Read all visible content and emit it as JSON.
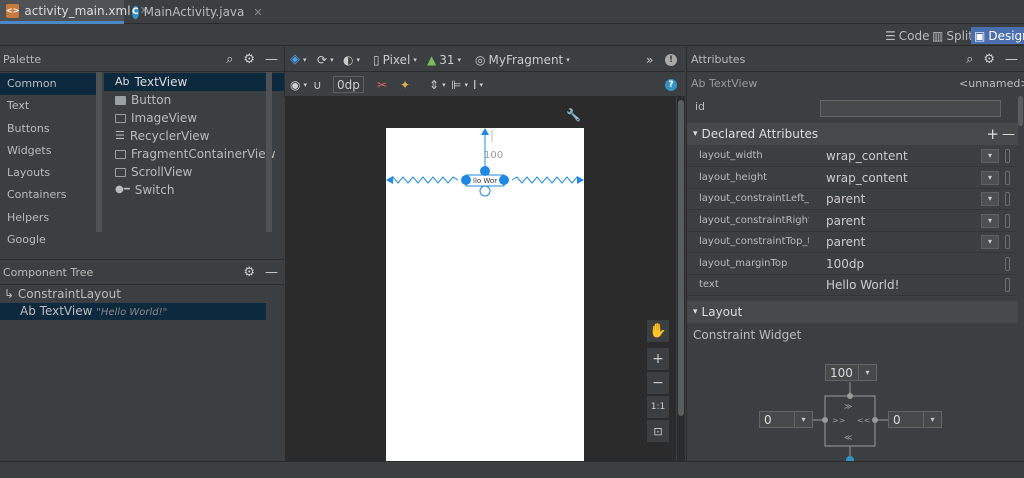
{
  "tabs": [
    {
      "label": "activity_main.xml",
      "icon": "xml-layout-icon"
    },
    {
      "label": "MainActivity.java",
      "icon": "java-class-icon"
    }
  ],
  "view_modes": {
    "code": "Code",
    "split": "Split",
    "design": "Design"
  },
  "palette": {
    "title": "Palette",
    "categories": [
      "Common",
      "Text",
      "Buttons",
      "Widgets",
      "Layouts",
      "Containers",
      "Helpers",
      "Google"
    ],
    "items": [
      "TextView",
      "Button",
      "ImageView",
      "RecyclerView",
      "FragmentContainerView",
      "ScrollView",
      "Switch"
    ],
    "textview_prefix": "Ab"
  },
  "component_tree": {
    "title": "Component Tree",
    "root": "ConstraintLayout",
    "child_prefix": "Ab",
    "child": "TextView",
    "child_hint": "\"Hello World!\""
  },
  "design_toolbar": {
    "device": "Pixel",
    "api": "31",
    "theme": "MyFragment",
    "margin": "0dp",
    "overflow": "»"
  },
  "canvas": {
    "margin_label": "100",
    "widget_text": "llo Wor"
  },
  "attributes": {
    "title": "Attributes",
    "widget_prefix": "Ab",
    "widget": "TextView",
    "widget_id_value": "<unnamed>",
    "id_label": "id",
    "declared_title": "Declared Attributes",
    "declared": [
      {
        "name": "layout_width",
        "value": "wrap_content",
        "dropdown": true
      },
      {
        "name": "layout_height",
        "value": "wrap_content",
        "dropdown": true
      },
      {
        "name": "layout_constraintLeft_toL...",
        "value": "parent",
        "dropdown": true
      },
      {
        "name": "layout_constraintRight_t...",
        "value": "parent",
        "dropdown": true
      },
      {
        "name": "layout_constraintTop_to...",
        "value": "parent",
        "dropdown": true
      },
      {
        "name": "layout_marginTop",
        "value": "100dp",
        "dropdown": false
      },
      {
        "name": "text",
        "value": "Hello World!",
        "dropdown": false
      }
    ],
    "layout_title": "Layout",
    "constraint_widget_title": "Constraint Widget",
    "constraint_top": "100",
    "constraint_left": "0",
    "constraint_right": "0"
  },
  "colors": {
    "accent": "#4b6eaf",
    "selection": "#0d293e",
    "blueprint": "#1e88e5"
  }
}
